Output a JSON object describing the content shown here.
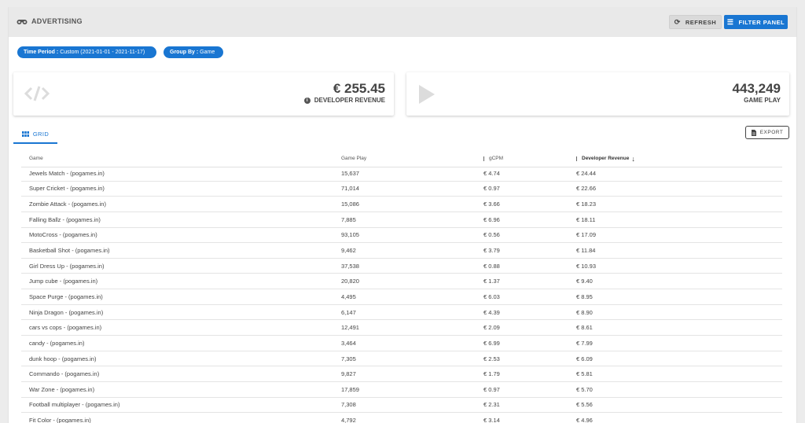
{
  "header": {
    "title": "ADVERTISING",
    "icon": "binoculars-icon",
    "refresh_label": "REFRESH",
    "filter_label": "FILTER PANEL",
    "accent": "#1976d2"
  },
  "chips": [
    {
      "key": "Time Period :",
      "value": "Custom (2021-01-01 - 2021-11-17)"
    },
    {
      "key": "Group By :",
      "value": "Game"
    }
  ],
  "cards": [
    {
      "value": "€ 255.45",
      "label": "DEVELOPER REVENUE",
      "icon": "code-icon"
    },
    {
      "value": "443,249",
      "label": "GAME PLAY",
      "icon": "play-icon"
    }
  ],
  "tab": {
    "label": "GRID"
  },
  "export_label": "EXPORT",
  "table": {
    "columns": [
      "Game",
      "Game Play",
      "gCPM",
      "Developer Revenue"
    ],
    "rows": [
      [
        "Jewels Match - (pogames.in)",
        "15,637",
        "€ 4.74",
        "€ 24.44"
      ],
      [
        "Super Cricket - (pogames.in)",
        "71,014",
        "€ 0.97",
        "€ 22.66"
      ],
      [
        "Zombie Attack - (pogames.in)",
        "15,086",
        "€ 3.66",
        "€ 18.23"
      ],
      [
        "Falling Ballz - (pogames.in)",
        "7,885",
        "€ 6.96",
        "€ 18.11"
      ],
      [
        "MotoCross - (pogames.in)",
        "93,105",
        "€ 0.56",
        "€ 17.09"
      ],
      [
        "Basketball Shot - (pogames.in)",
        "9,462",
        "€ 3.79",
        "€ 11.84"
      ],
      [
        "Girl Dress Up - (pogames.in)",
        "37,538",
        "€ 0.88",
        "€ 10.93"
      ],
      [
        "Jump cube - (pogames.in)",
        "20,820",
        "€ 1.37",
        "€ 9.40"
      ],
      [
        "Space Purge - (pogames.in)",
        "4,495",
        "€ 6.03",
        "€ 8.95"
      ],
      [
        "Ninja Dragon - (pogames.in)",
        "6,147",
        "€ 4.39",
        "€ 8.90"
      ],
      [
        "cars vs cops - (pogames.in)",
        "12,491",
        "€ 2.09",
        "€ 8.61"
      ],
      [
        "candy - (pogames.in)",
        "3,464",
        "€ 6.99",
        "€ 7.99"
      ],
      [
        "dunk hoop - (pogames.in)",
        "7,305",
        "€ 2.53",
        "€ 6.09"
      ],
      [
        "Commando - (pogames.in)",
        "9,827",
        "€ 1.79",
        "€ 5.81"
      ],
      [
        "War Zone - (pogames.in)",
        "17,859",
        "€ 0.97",
        "€ 5.70"
      ],
      [
        "Football multiplayer - (pogames.in)",
        "7,308",
        "€ 2.31",
        "€ 5.56"
      ],
      [
        "Fit Color - (pogames.in)",
        "4,792",
        "€ 3.14",
        "€ 4.96"
      ]
    ]
  }
}
